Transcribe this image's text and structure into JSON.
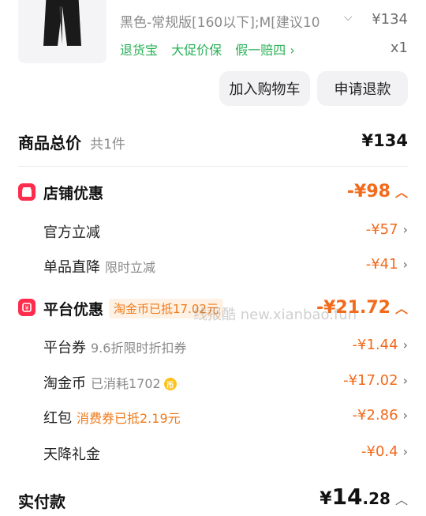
{
  "product": {
    "variant": "黑色-常规版[160以下];M[建议10",
    "price": "¥134",
    "quantity": "x1",
    "tags": [
      "退货宝",
      "大促价保",
      "假一赔四"
    ]
  },
  "actions": {
    "add_to_cart": "加入购物车",
    "apply_refund": "申请退款"
  },
  "summary": {
    "goods_total_label": "商品总价",
    "goods_count": "共1件",
    "goods_total_value": "¥134"
  },
  "store_discount": {
    "label": "店铺优惠",
    "value": "-¥98",
    "items": [
      {
        "label": "官方立减",
        "sub": "",
        "value": "-¥57"
      },
      {
        "label": "单品直降",
        "sub": "限时立减",
        "value": "-¥41"
      }
    ]
  },
  "platform_discount": {
    "label": "平台优惠",
    "pill": "淘金币已抵17.02元",
    "value": "-¥21.72",
    "items": [
      {
        "label": "平台券",
        "sub": "9.6折限时折扣券",
        "value": "-¥1.44"
      },
      {
        "label": "淘金币",
        "sub": "已消耗1702",
        "value": "-¥17.02"
      },
      {
        "label": "红包",
        "sub": "消费券已抵2.19元",
        "value": "-¥2.86"
      },
      {
        "label": "天降礼金",
        "sub": "",
        "value": "-¥0.4"
      }
    ]
  },
  "payment": {
    "label": "实付款",
    "currency": "¥",
    "integer": "14",
    "decimal": ".28"
  },
  "watermark": "线报酷 new.xianbao.fun",
  "colors": {
    "accent_orange": "#f26a1b",
    "tag_green": "#2ab157",
    "badge_red": "#ff2d4d"
  }
}
